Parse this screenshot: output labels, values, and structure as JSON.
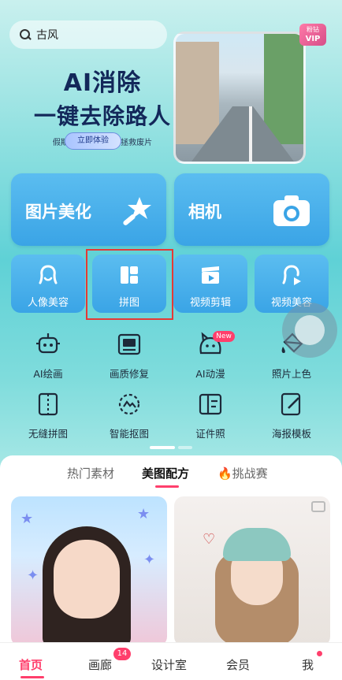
{
  "search": {
    "value": "古风"
  },
  "banner": {
    "title_line1": "AI消除",
    "title_line2": "一键去除路人",
    "subtitle": "假期出游必备，1秒拯救废片",
    "button": "立即体验",
    "vip_top": "粉钻",
    "vip_bottom": "VIP"
  },
  "big_cards": [
    {
      "label": "图片美化",
      "icon": "magic-wand-icon"
    },
    {
      "label": "相机",
      "icon": "camera-icon"
    }
  ],
  "small_cards": [
    {
      "label": "人像美容",
      "icon": "face-outline-icon"
    },
    {
      "label": "拼图",
      "icon": "collage-grid-icon"
    },
    {
      "label": "视频剪辑",
      "icon": "clapperboard-icon"
    },
    {
      "label": "视频美容",
      "icon": "video-face-icon"
    }
  ],
  "tools_row1": [
    {
      "label": "AI绘画",
      "icon": "robot-icon"
    },
    {
      "label": "画质修复",
      "icon": "hd-icon"
    },
    {
      "label": "AI动漫",
      "icon": "anime-cat-icon"
    },
    {
      "label": "照片上色",
      "icon": "paint-bucket-icon"
    }
  ],
  "tools_row2": [
    {
      "label": "无缝拼图",
      "icon": "seamless-collage-icon"
    },
    {
      "label": "智能抠图",
      "icon": "cutout-icon"
    },
    {
      "label": "证件照",
      "icon": "id-photo-icon"
    },
    {
      "label": "海报模板",
      "icon": "poster-edit-icon"
    }
  ],
  "new_badge": "New",
  "feed_tabs": [
    "热门素材",
    "美图配方",
    "🔥挑战赛"
  ],
  "feed_active_tab": "美图配方",
  "nav": [
    {
      "label": "首页"
    },
    {
      "label": "画廊"
    },
    {
      "label": "设计室"
    },
    {
      "label": "会员"
    },
    {
      "label": "我"
    }
  ],
  "gallery_badge": "14",
  "colors": {
    "accent": "#ff3f6c",
    "card_blue": "#3aa4e6",
    "highlight_red": "#e53935"
  }
}
